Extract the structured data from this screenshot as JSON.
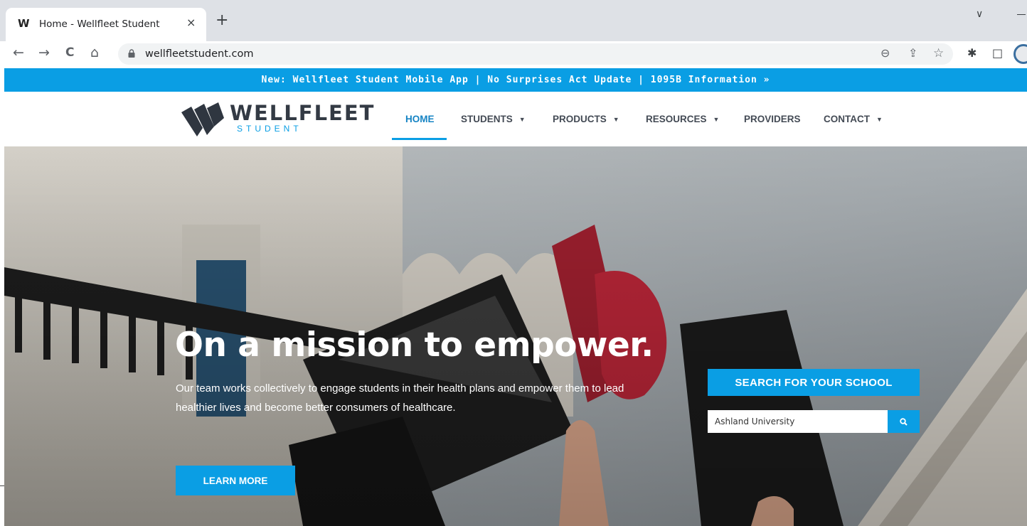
{
  "browser": {
    "tab_title": "Home - Wellfleet Student",
    "tab_favicon": "W",
    "close_glyph": "×",
    "newtab_glyph": "+",
    "tabsearch_glyph": "∨",
    "url": "wellfleetstudent.com",
    "icons": {
      "back": "←",
      "forward": "→",
      "reload": "C",
      "home": "⌂",
      "zoom": "⊖",
      "share": "⇪",
      "bookmark": "☆",
      "extensions": "✱",
      "sidepanel": "□"
    }
  },
  "promo": {
    "text": "New: Wellfleet Student Mobile App | No Surprises Act Update | 1095B Information »"
  },
  "logo": {
    "word": "WELLFLEET",
    "sub": "STUDENT"
  },
  "nav": {
    "items": [
      {
        "label": "HOME",
        "active": true
      },
      {
        "label": "STUDENTS",
        "dropdown": true
      },
      {
        "label": "PRODUCTS",
        "dropdown": true
      },
      {
        "label": "RESOURCES",
        "dropdown": true
      },
      {
        "label": "PROVIDERS"
      },
      {
        "label": "CONTACT",
        "dropdown": true
      }
    ],
    "caret": "▼"
  },
  "hero": {
    "title": "On a mission to empower.",
    "body": "Our team works collectively to engage students in their health plans and empower them to lead healthier lives and become better consumers of healthcare.",
    "cta": "LEARN MORE"
  },
  "school_search": {
    "heading": "SEARCH FOR YOUR SCHOOL",
    "value": "Ashland University",
    "placeholder": ""
  },
  "colors": {
    "brand_blue": "#0a9ee4",
    "nav_text": "#444b55",
    "logo_dark": "#333a44"
  }
}
